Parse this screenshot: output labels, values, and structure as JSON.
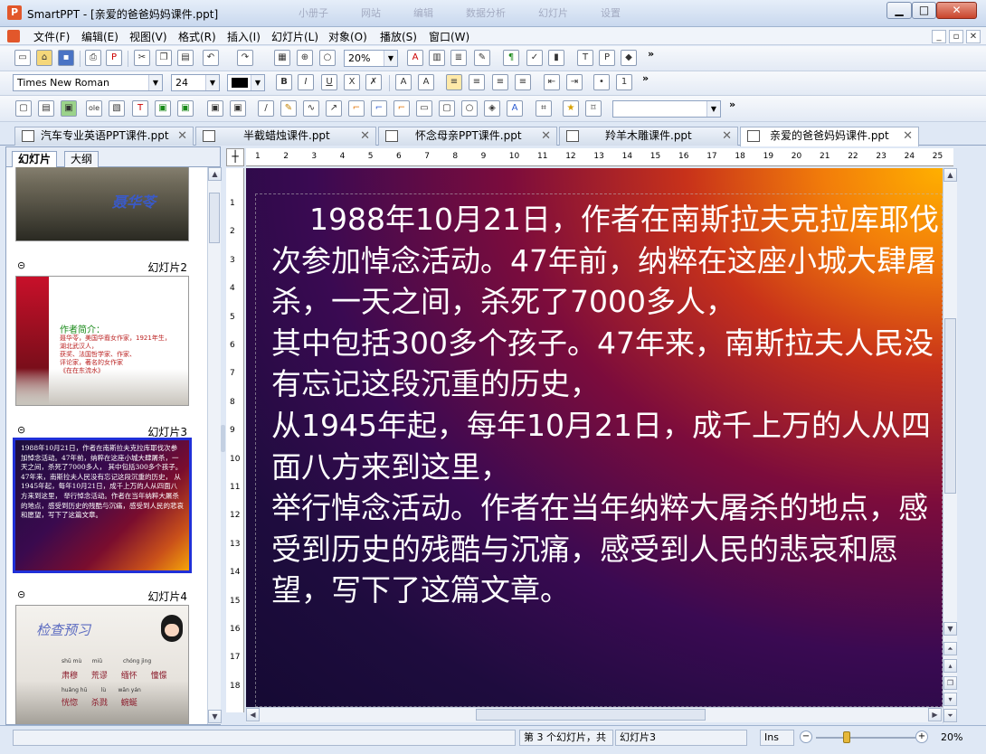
{
  "window": {
    "title": "SmartPPT - [亲爱的爸爸妈妈课件.ppt]",
    "app_icon": "P",
    "background_tabs": [
      "小册子",
      "网站",
      "编辑",
      "数据分析",
      "幻灯片",
      "设置"
    ],
    "min_icon": "▁",
    "max_icon": "□",
    "close_icon": "✕"
  },
  "menu": {
    "items": [
      "文件(F)",
      "编辑(E)",
      "视图(V)",
      "格式(R)",
      "插入(I)",
      "幻灯片(L)",
      "对象(O)",
      "播放(S)",
      "窗口(W)"
    ],
    "mdi": [
      "_",
      "▫",
      "✕"
    ]
  },
  "toolbar1": {
    "zoom_value": "20%",
    "more": "»"
  },
  "toolbar2": {
    "font_name": "Times New Roman",
    "font_size": "24",
    "bold": "B",
    "italic": "I",
    "underline": "U",
    "strike": "X",
    "more": "»"
  },
  "toolbar3": {
    "shape_select": "",
    "more": "»"
  },
  "doc_tabs": [
    {
      "label": "汽车专业英语PPT课件.ppt",
      "active": false
    },
    {
      "label": "半截蜡烛课件.ppt",
      "active": false
    },
    {
      "label": "怀念母亲PPT课件.ppt",
      "active": false
    },
    {
      "label": "羚羊木雕课件.ppt",
      "active": false
    },
    {
      "label": "亲爱的爸爸妈妈课件.ppt",
      "active": true
    }
  ],
  "left_panel": {
    "tab_slides": "幻灯片",
    "tab_outline": "大纲",
    "slide1_caption": "聂华苓",
    "slide2_label": "幻灯片2",
    "slide2_heading": "作者简介：",
    "slide2_lines": [
      "聂华苓，美国华裔女作家，1921年生，",
      "湖北武汉人，",
      "获奖、法国哲学家、作家、",
      "评论家，著名的女作家",
      "《在在东流水》"
    ],
    "slide3_label": "幻灯片3",
    "slide4_label": "幻灯片4",
    "slide4_heading": "检查预习",
    "slide4_pinyin": [
      "shū mù",
      "miǔ",
      "chóng jìng"
    ],
    "slide4_words": [
      "肃穆",
      "荒谬",
      "缅怀",
      "憧憬"
    ],
    "slide4_pinyin2": [
      "huǎng hū",
      "lù",
      "wān yán"
    ],
    "slide4_words2": [
      "恍惚",
      "杀戮",
      "蜿蜒"
    ]
  },
  "slide": {
    "text": "    1988年10月21日，作者在南斯拉夫克拉库耶伐次参加悼念活动。47年前，纳粹在这座小城大肆屠杀，一天之间，杀死了7000多人，\n其中包括300多个孩子。47年来，南斯拉夫人民没有忘记这段沉重的历史，\n从1945年起，每年10月21日，成千上万的人从四面八方来到这里，\n举行悼念活动。作者在当年纳粹大屠杀的地点，感受到历史的残酷与沉痛，感受到人民的悲哀和愿望，写下了这篇文章。"
  },
  "ruler": {
    "h_ticks": [
      "1",
      "2",
      "3",
      "4",
      "5",
      "6",
      "7",
      "8",
      "9",
      "10",
      "11",
      "12",
      "13",
      "14",
      "15",
      "16",
      "17",
      "18",
      "19",
      "20",
      "21",
      "22",
      "23",
      "24",
      "25"
    ],
    "v_ticks": [
      "1",
      "2",
      "3",
      "4",
      "5",
      "6",
      "7",
      "8",
      "9",
      "10",
      "11",
      "12",
      "13",
      "14",
      "15",
      "16",
      "17",
      "18"
    ]
  },
  "status": {
    "slide_pos": "第 3 个幻灯片，共",
    "slide_name": "幻灯片3",
    "ins": "Ins",
    "zoom": "20%"
  },
  "colors": {
    "accent": "#2030d8",
    "chrome": "#dfe8f5"
  }
}
